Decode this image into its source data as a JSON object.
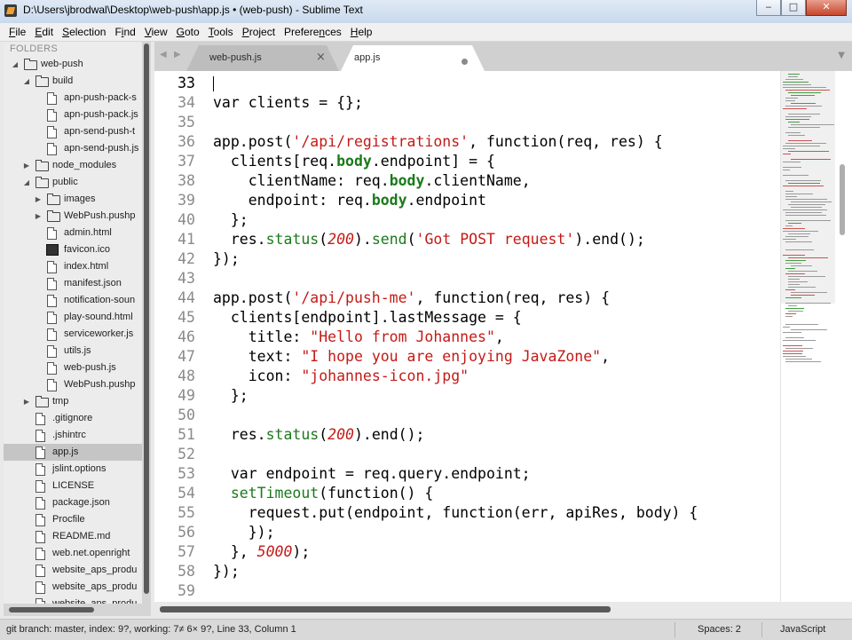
{
  "window": {
    "title": "D:\\Users\\jbrodwal\\Desktop\\web-push\\app.js • (web-push) - Sublime Text",
    "minimize_icon": "minimize-icon",
    "maximize_icon": "maximize-icon",
    "close_icon": "close-icon",
    "minimize_glyph": "‒",
    "maximize_glyph": "□",
    "close_glyph": "✕"
  },
  "menu": [
    {
      "pre": "",
      "key": "F",
      "post": "ile"
    },
    {
      "pre": "",
      "key": "E",
      "post": "dit"
    },
    {
      "pre": "",
      "key": "S",
      "post": "election"
    },
    {
      "pre": "F",
      "key": "i",
      "post": "nd"
    },
    {
      "pre": "",
      "key": "V",
      "post": "iew"
    },
    {
      "pre": "",
      "key": "G",
      "post": "oto"
    },
    {
      "pre": "",
      "key": "T",
      "post": "ools"
    },
    {
      "pre": "",
      "key": "P",
      "post": "roject"
    },
    {
      "pre": "Prefere",
      "key": "n",
      "post": "ces"
    },
    {
      "pre": "",
      "key": "H",
      "post": "elp"
    }
  ],
  "sidebar": {
    "header": "FOLDERS",
    "items": [
      {
        "label": "web-push",
        "type": "folder",
        "expanded": true,
        "depth": 0
      },
      {
        "label": "build",
        "type": "folder",
        "expanded": true,
        "depth": 1
      },
      {
        "label": "apn-push-pack-s",
        "type": "file",
        "depth": 2
      },
      {
        "label": "apn-push-pack.js",
        "type": "file",
        "depth": 2
      },
      {
        "label": "apn-send-push-t",
        "type": "file",
        "depth": 2
      },
      {
        "label": "apn-send-push.js",
        "type": "file",
        "depth": 2
      },
      {
        "label": "node_modules",
        "type": "folder",
        "expanded": false,
        "depth": 1
      },
      {
        "label": "public",
        "type": "folder",
        "expanded": true,
        "depth": 1
      },
      {
        "label": "images",
        "type": "folder",
        "expanded": false,
        "depth": 2
      },
      {
        "label": "WebPush.pushp",
        "type": "folder",
        "expanded": false,
        "depth": 2
      },
      {
        "label": "admin.html",
        "type": "file",
        "depth": 2
      },
      {
        "label": "favicon.ico",
        "type": "image",
        "depth": 2
      },
      {
        "label": "index.html",
        "type": "file",
        "depth": 2
      },
      {
        "label": "manifest.json",
        "type": "file",
        "depth": 2
      },
      {
        "label": "notification-soun",
        "type": "file",
        "depth": 2
      },
      {
        "label": "play-sound.html",
        "type": "file",
        "depth": 2
      },
      {
        "label": "serviceworker.js",
        "type": "file",
        "depth": 2
      },
      {
        "label": "utils.js",
        "type": "file",
        "depth": 2
      },
      {
        "label": "web-push.js",
        "type": "file",
        "depth": 2
      },
      {
        "label": "WebPush.pushp",
        "type": "file",
        "depth": 2
      },
      {
        "label": "tmp",
        "type": "folder",
        "expanded": false,
        "depth": 1
      },
      {
        "label": ".gitignore",
        "type": "file",
        "depth": 1
      },
      {
        "label": ".jshintrc",
        "type": "file",
        "depth": 1
      },
      {
        "label": "app.js",
        "type": "file",
        "depth": 1,
        "selected": true
      },
      {
        "label": "jslint.options",
        "type": "file",
        "depth": 1
      },
      {
        "label": "LICENSE",
        "type": "file",
        "depth": 1
      },
      {
        "label": "package.json",
        "type": "file",
        "depth": 1
      },
      {
        "label": "Procfile",
        "type": "file",
        "depth": 1
      },
      {
        "label": "README.md",
        "type": "file",
        "depth": 1
      },
      {
        "label": "web.net.openright",
        "type": "file",
        "depth": 1
      },
      {
        "label": "website_aps_produ",
        "type": "file",
        "depth": 1
      },
      {
        "label": "website_aps_produ",
        "type": "file",
        "depth": 1
      },
      {
        "label": "website_aps_produ",
        "type": "file",
        "depth": 1
      }
    ]
  },
  "tabs": {
    "prev_glyph": "◀",
    "next_glyph": "▶",
    "dropdown_glyph": "▼",
    "items": [
      {
        "label": "web-push.js",
        "active": false,
        "dirty": false,
        "close_glyph": "×"
      },
      {
        "label": "app.js",
        "active": true,
        "dirty": true
      }
    ]
  },
  "editor": {
    "cursor_line": 33,
    "lines": [
      {
        "num": 33,
        "tokens": []
      },
      {
        "num": 34,
        "tokens": [
          {
            "t": "var clients = {};"
          }
        ]
      },
      {
        "num": 35,
        "tokens": []
      },
      {
        "num": 36,
        "tokens": [
          {
            "t": "app.post("
          },
          {
            "t": "'/api/registrations'",
            "c": "str"
          },
          {
            "t": ", function(req, res) {"
          }
        ]
      },
      {
        "num": 37,
        "tokens": [
          {
            "t": "  clients[req."
          },
          {
            "t": "body",
            "c": "fn"
          },
          {
            "t": ".endpoint] = {"
          }
        ]
      },
      {
        "num": 38,
        "tokens": [
          {
            "t": "    clientName: req."
          },
          {
            "t": "body",
            "c": "fn"
          },
          {
            "t": ".clientName,"
          }
        ]
      },
      {
        "num": 39,
        "tokens": [
          {
            "t": "    endpoint: req."
          },
          {
            "t": "body",
            "c": "fn"
          },
          {
            "t": ".endpoint"
          }
        ]
      },
      {
        "num": 40,
        "tokens": [
          {
            "t": "  };"
          }
        ]
      },
      {
        "num": 41,
        "tokens": [
          {
            "t": "  res."
          },
          {
            "t": "status",
            "c": "fnn"
          },
          {
            "t": "("
          },
          {
            "t": "200",
            "c": "num"
          },
          {
            "t": ")."
          },
          {
            "t": "send",
            "c": "fnn"
          },
          {
            "t": "("
          },
          {
            "t": "'Got POST request'",
            "c": "str"
          },
          {
            "t": ").end();"
          }
        ]
      },
      {
        "num": 42,
        "tokens": [
          {
            "t": "});"
          }
        ]
      },
      {
        "num": 43,
        "tokens": []
      },
      {
        "num": 44,
        "tokens": [
          {
            "t": "app.post("
          },
          {
            "t": "'/api/push-me'",
            "c": "str"
          },
          {
            "t": ", function(req, res) {"
          }
        ]
      },
      {
        "num": 45,
        "tokens": [
          {
            "t": "  clients[endpoint].lastMessage = {"
          }
        ]
      },
      {
        "num": 46,
        "tokens": [
          {
            "t": "    title: "
          },
          {
            "t": "\"Hello from Johannes\"",
            "c": "str"
          },
          {
            "t": ","
          }
        ]
      },
      {
        "num": 47,
        "tokens": [
          {
            "t": "    text: "
          },
          {
            "t": "\"I hope you are enjoying JavaZone\"",
            "c": "str"
          },
          {
            "t": ","
          }
        ]
      },
      {
        "num": 48,
        "tokens": [
          {
            "t": "    icon: "
          },
          {
            "t": "\"johannes-icon.jpg\"",
            "c": "str"
          }
        ]
      },
      {
        "num": 49,
        "tokens": [
          {
            "t": "  };"
          }
        ]
      },
      {
        "num": 50,
        "tokens": []
      },
      {
        "num": 51,
        "tokens": [
          {
            "t": "  res."
          },
          {
            "t": "status",
            "c": "fnn"
          },
          {
            "t": "("
          },
          {
            "t": "200",
            "c": "num"
          },
          {
            "t": ").end();"
          }
        ]
      },
      {
        "num": 52,
        "tokens": []
      },
      {
        "num": 53,
        "tokens": [
          {
            "t": "  var endpoint = req.query.endpoint;"
          }
        ]
      },
      {
        "num": 54,
        "tokens": [
          {
            "t": "  "
          },
          {
            "t": "setTimeout",
            "c": "fnn"
          },
          {
            "t": "(function() {"
          }
        ]
      },
      {
        "num": 55,
        "tokens": [
          {
            "t": "    request.put(endpoint, function(err, apiRes, body) {"
          }
        ]
      },
      {
        "num": 56,
        "tokens": [
          {
            "t": "    });"
          }
        ]
      },
      {
        "num": 57,
        "tokens": [
          {
            "t": "  }, "
          },
          {
            "t": "5000",
            "c": "num"
          },
          {
            "t": ");"
          }
        ]
      },
      {
        "num": 58,
        "tokens": [
          {
            "t": "});"
          }
        ]
      },
      {
        "num": 59,
        "tokens": []
      }
    ]
  },
  "colors": {
    "string": "#c41a16",
    "function": "#1a7a1a",
    "number": "#c41a16",
    "selection": "#c5c5c5"
  },
  "statusbar": {
    "left": "git branch: master, index: 9?, working: 7≠ 6× 9?, Line 33, Column 1",
    "spaces": "Spaces: 2",
    "syntax": "JavaScript"
  }
}
